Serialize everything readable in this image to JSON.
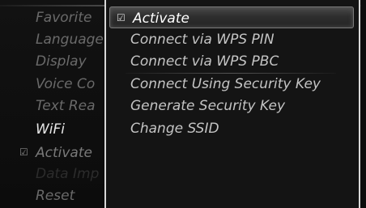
{
  "left_menu": {
    "items": [
      {
        "label": "Favorite",
        "state": "normal"
      },
      {
        "label": "Language",
        "state": "normal"
      },
      {
        "label": "Display",
        "state": "normal"
      },
      {
        "label": "Voice Co",
        "state": "normal"
      },
      {
        "label": "Text Rea",
        "state": "normal"
      },
      {
        "label": "WiFi",
        "state": "active"
      },
      {
        "label": "Activate",
        "state": "checked",
        "check_icon": "checkmark-icon"
      },
      {
        "label": "Data Imp",
        "state": "disabled"
      },
      {
        "label": "Reset",
        "state": "normal"
      }
    ]
  },
  "submenu": {
    "items": [
      {
        "label": "Activate",
        "checked": true,
        "selected": true
      },
      {
        "label": "Connect via WPS PIN"
      },
      {
        "label": "Connect via WPS PBC"
      },
      {
        "label": "Connect Using Security Key"
      },
      {
        "label": "Generate Security Key"
      },
      {
        "label": "Change SSID"
      }
    ],
    "check_glyph": "☑"
  }
}
